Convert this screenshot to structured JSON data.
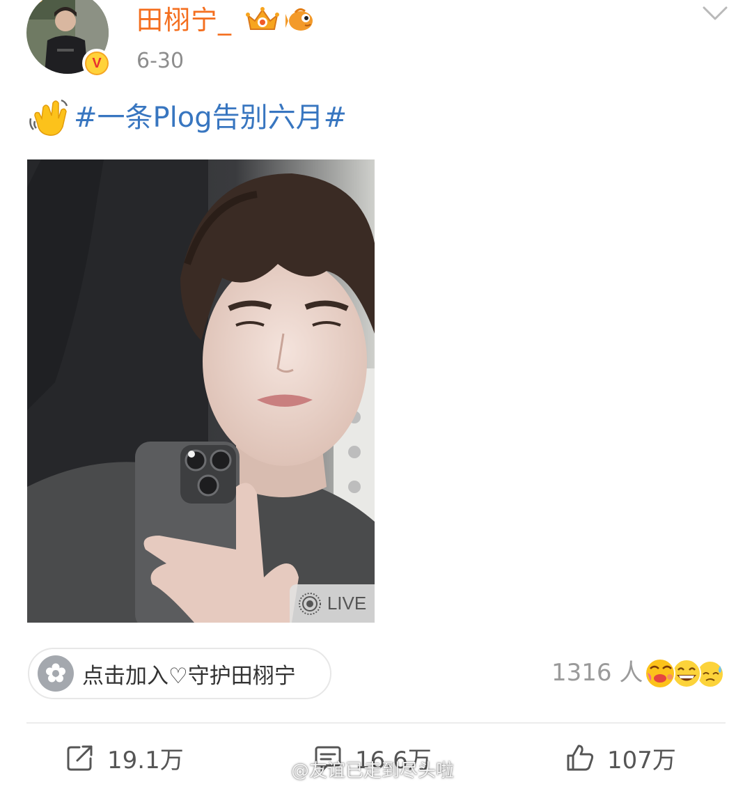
{
  "header": {
    "username": "田栩宁_",
    "date": "6-30",
    "verified_mark": "V",
    "badges": [
      "crown-level-badge",
      "fish-badge"
    ],
    "menu_icon": "chevron-down-icon"
  },
  "post": {
    "emoji": "waving-hand-icon",
    "hashtag": "#一条Plog告别六月#"
  },
  "media": {
    "live_label": "LIVE",
    "live_icon": "live-photo-icon"
  },
  "fanclub": {
    "label": "点击加入♡守护田栩宁",
    "icon": "flower-icon",
    "people_count": "1316 人",
    "reaction_icons": [
      "blowing-kiss-icon",
      "grinning-icon",
      "sweat-icon"
    ]
  },
  "actions": {
    "repost": {
      "icon": "repost-icon",
      "count": "19.1万"
    },
    "comment": {
      "icon": "comment-icon",
      "count": "16.6万"
    },
    "like": {
      "icon": "thumbs-up-icon",
      "count": "107万"
    }
  },
  "watermark": "@友谊已走到尽头啦",
  "colors": {
    "username": "#f46e1e",
    "hashtag": "#3876c0",
    "muted": "#8d8d8d"
  }
}
